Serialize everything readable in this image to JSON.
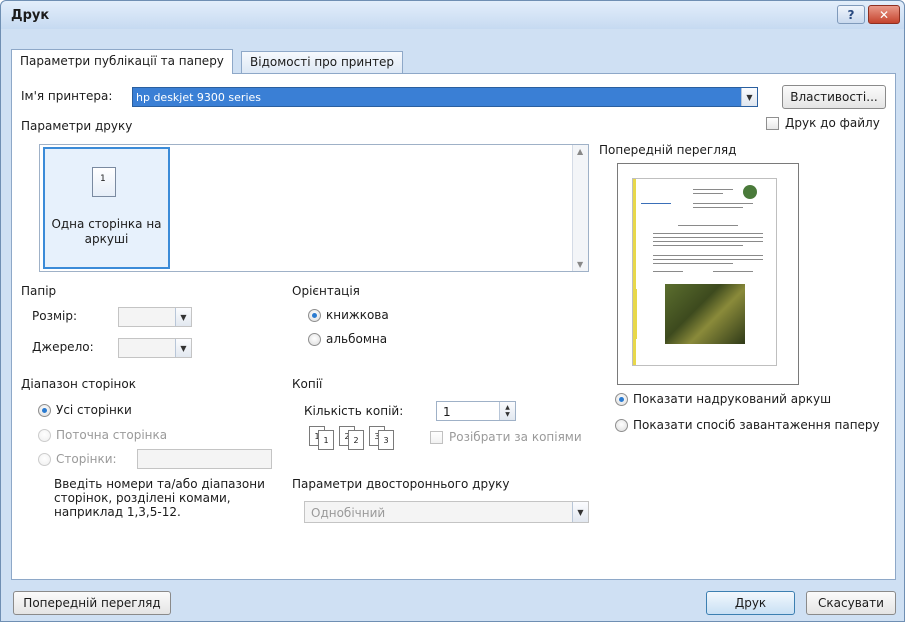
{
  "window": {
    "title": "Друк"
  },
  "tabs": [
    "Параметри публікації та паперу",
    "Відомості про принтер"
  ],
  "printer": {
    "label": "Ім'я принтера:",
    "value": "hp deskjet 9300 series",
    "properties_button": "Властивості...",
    "print_to_file_label": "Друк до файлу"
  },
  "print_options": {
    "label": "Параметри друку",
    "item": "Одна сторінка на аркуші"
  },
  "preview": {
    "label": "Попередній перегляд",
    "option_printed": "Показати надрукований аркуш",
    "option_feed": "Показати спосіб завантаження паперу"
  },
  "paper": {
    "label": "Папір",
    "size_label": "Розмір:",
    "source_label": "Джерело:"
  },
  "orientation": {
    "label": "Орієнтація",
    "portrait": "книжкова",
    "landscape": "альбомна"
  },
  "page_range": {
    "label": "Діапазон сторінок",
    "all": "Усі сторінки",
    "current": "Поточна сторінка",
    "pages": "Сторінки:",
    "hint": "Введіть номери та/або діапазони сторінок, розділені комами, наприклад 1,3,5-12."
  },
  "copies": {
    "label": "Копії",
    "count_label": "Кількість копій:",
    "count_value": "1",
    "collate_label": "Розібрати за копіями"
  },
  "duplex": {
    "label": "Параметри двостороннього друку",
    "value": "Однобічний"
  },
  "footer": {
    "preview_button": "Попередній перегляд",
    "print_button": "Друк",
    "cancel_button": "Скасувати"
  }
}
